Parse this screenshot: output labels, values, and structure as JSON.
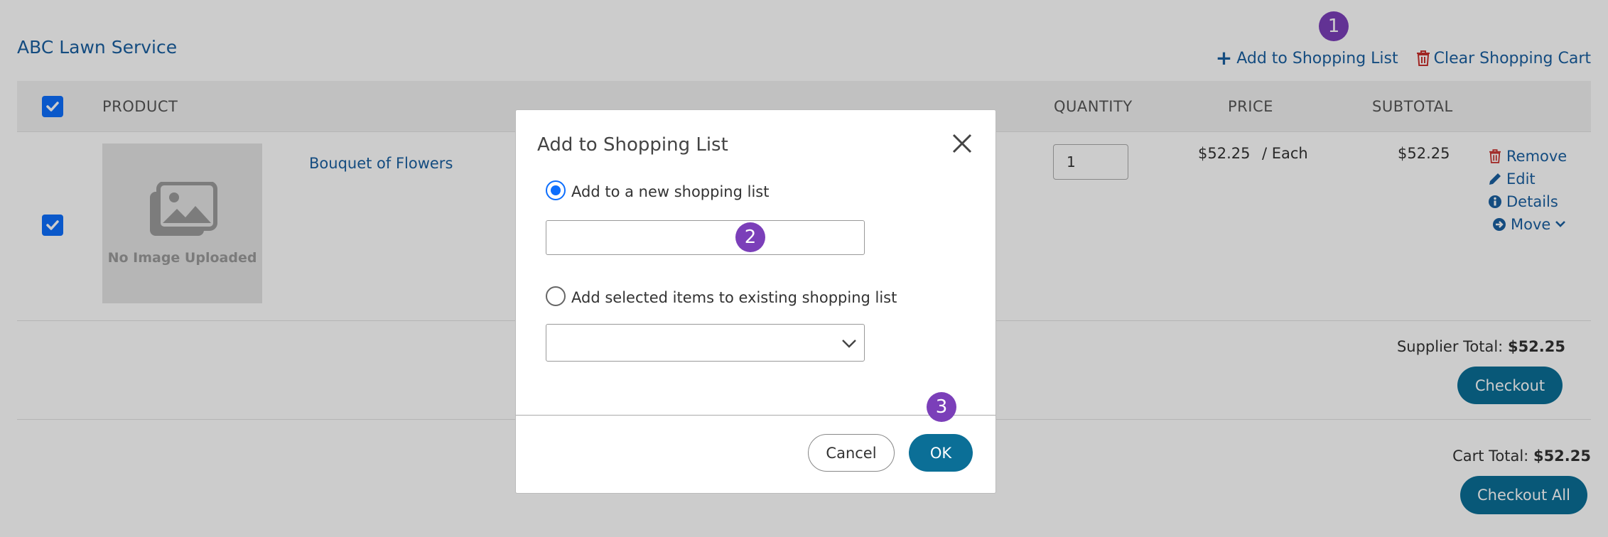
{
  "supplier": {
    "name": "ABC Lawn Service"
  },
  "top_actions": {
    "add_to_list": "Add to Shopping List",
    "clear_cart": "Clear Shopping Cart"
  },
  "table_headers": {
    "product": "PRODUCT",
    "quantity": "QUANTITY",
    "price": "PRICE",
    "subtotal": "SUBTOTAL"
  },
  "item": {
    "image_placeholder": "No Image Uploaded",
    "name": "Bouquet of Flowers",
    "quantity": "1",
    "price": "$52.25",
    "unit": "/ Each",
    "subtotal": "$52.25",
    "actions": {
      "remove": "Remove",
      "edit": "Edit",
      "details": "Details",
      "move": "Move"
    }
  },
  "supplier_total": {
    "label": "Supplier Total:",
    "value": "$52.25",
    "checkout": "Checkout"
  },
  "cart_total": {
    "label": "Cart Total:",
    "value": "$52.25",
    "checkout_all": "Checkout All"
  },
  "modal": {
    "title": "Add to Shopping List",
    "option_new": "Add to a new shopping list",
    "option_existing": "Add selected items to existing shopping list",
    "new_list_value": "",
    "existing_list_value": "",
    "cancel": "Cancel",
    "ok": "OK"
  },
  "badges": [
    "1",
    "2",
    "3"
  ],
  "colors": {
    "link": "#1a5fa0",
    "primary_button": "#0b6f97",
    "danger": "#c9302c",
    "checkbox": "#0d6efd",
    "badge": "#7b3fb9"
  }
}
